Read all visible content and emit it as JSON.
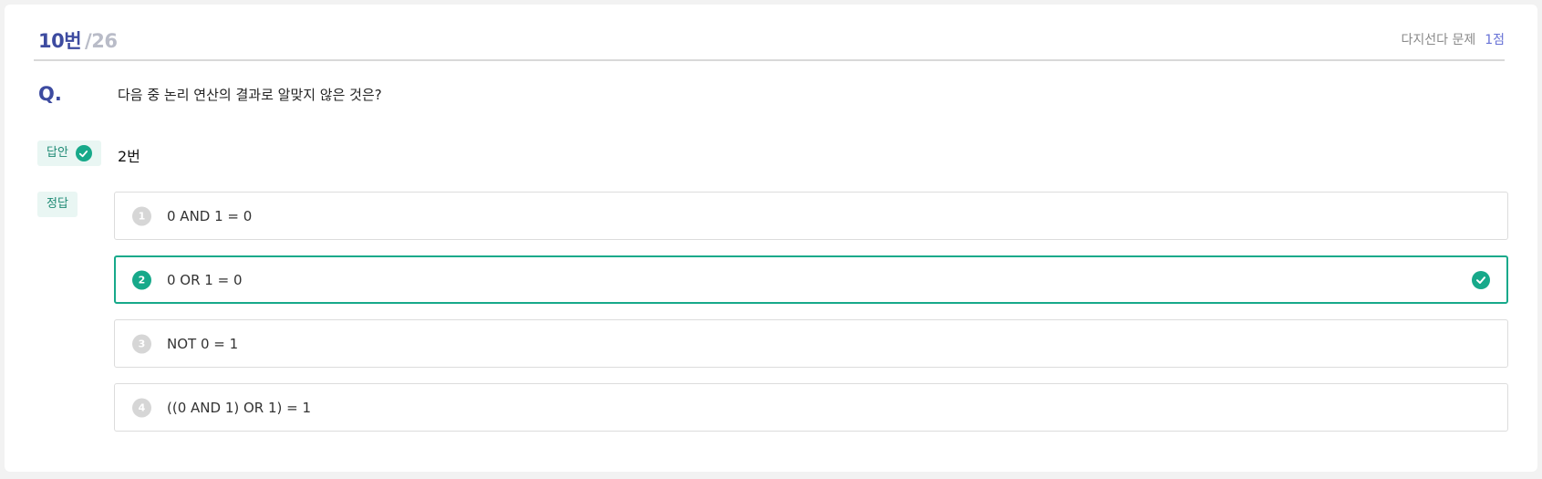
{
  "header": {
    "question_number": "10번",
    "question_total": "/26",
    "question_type": "다지선다 문제",
    "points": "1점"
  },
  "question": {
    "label": "Q.",
    "text": "다음 중 논리 연산의 결과로 알맞지 않은 것은?"
  },
  "answer": {
    "tag": "답안",
    "value": "2번"
  },
  "correct": {
    "tag": "정답"
  },
  "options": [
    {
      "num": "1",
      "text": "0 AND 1 = 0",
      "selected": false
    },
    {
      "num": "2",
      "text": "0 OR 1 = 0",
      "selected": true
    },
    {
      "num": "3",
      "text": "NOT 0 = 1",
      "selected": false
    },
    {
      "num": "4",
      "text": "((0 AND 1) OR 1) = 1",
      "selected": false
    }
  ],
  "colors": {
    "accent_green": "#17a98a",
    "title_blue": "#3d4ba0",
    "points_blue": "#6873d6"
  },
  "icons": {
    "answer_status": "check-circle-icon",
    "selected_option": "check-circle-icon"
  }
}
